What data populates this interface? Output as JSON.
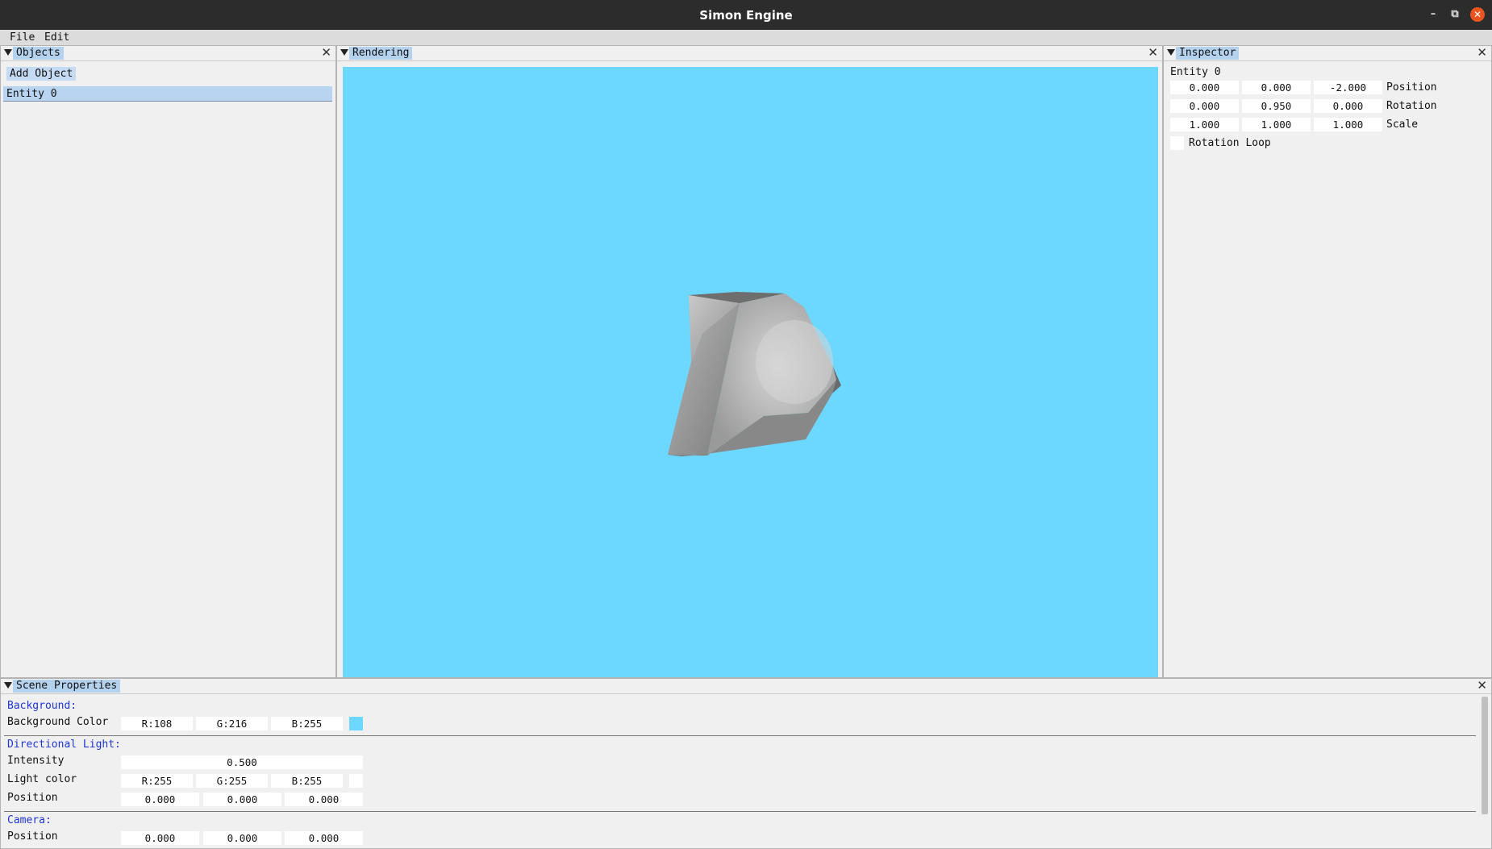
{
  "window": {
    "title": "Simon Engine"
  },
  "menu": {
    "file": "File",
    "edit": "Edit"
  },
  "objects_panel": {
    "title": "Objects",
    "add_button": "Add Object",
    "items": [
      "Entity 0"
    ]
  },
  "rendering_panel": {
    "title": "Rendering",
    "background_color": "#6cd8ff"
  },
  "inspector": {
    "title": "Inspector",
    "entity_name": "Entity 0",
    "position": {
      "label": "Position",
      "values": [
        "0.000",
        "0.000",
        "-2.000"
      ]
    },
    "rotation": {
      "label": "Rotation",
      "values": [
        "0.000",
        "0.950",
        "0.000"
      ]
    },
    "scale": {
      "label": "Scale",
      "values": [
        "1.000",
        "1.000",
        "1.000"
      ]
    },
    "rotation_loop": {
      "label": "Rotation Loop",
      "checked": false
    }
  },
  "scene_properties": {
    "title": "Scene Properties",
    "background": {
      "header": "Background:",
      "color_label": "Background Color",
      "r": "R:108",
      "g": "G:216",
      "b": "B:255",
      "swatch": "#6cd8ff"
    },
    "directional_light": {
      "header": "Directional Light:",
      "intensity_label": "Intensity",
      "intensity": "0.500",
      "color_label": "Light color",
      "r": "R:255",
      "g": "G:255",
      "b": "B:255",
      "swatch": "#ffffff",
      "position_label": "Position",
      "position": [
        "0.000",
        "0.000",
        "0.000"
      ]
    },
    "camera": {
      "header": "Camera:",
      "position_label": "Position",
      "position": [
        "0.000",
        "0.000",
        "0.000"
      ]
    }
  },
  "icons": {
    "collapse": "triangle-down-icon",
    "close": "close-icon",
    "minimize": "minimize-icon",
    "restore": "restore-icon"
  }
}
